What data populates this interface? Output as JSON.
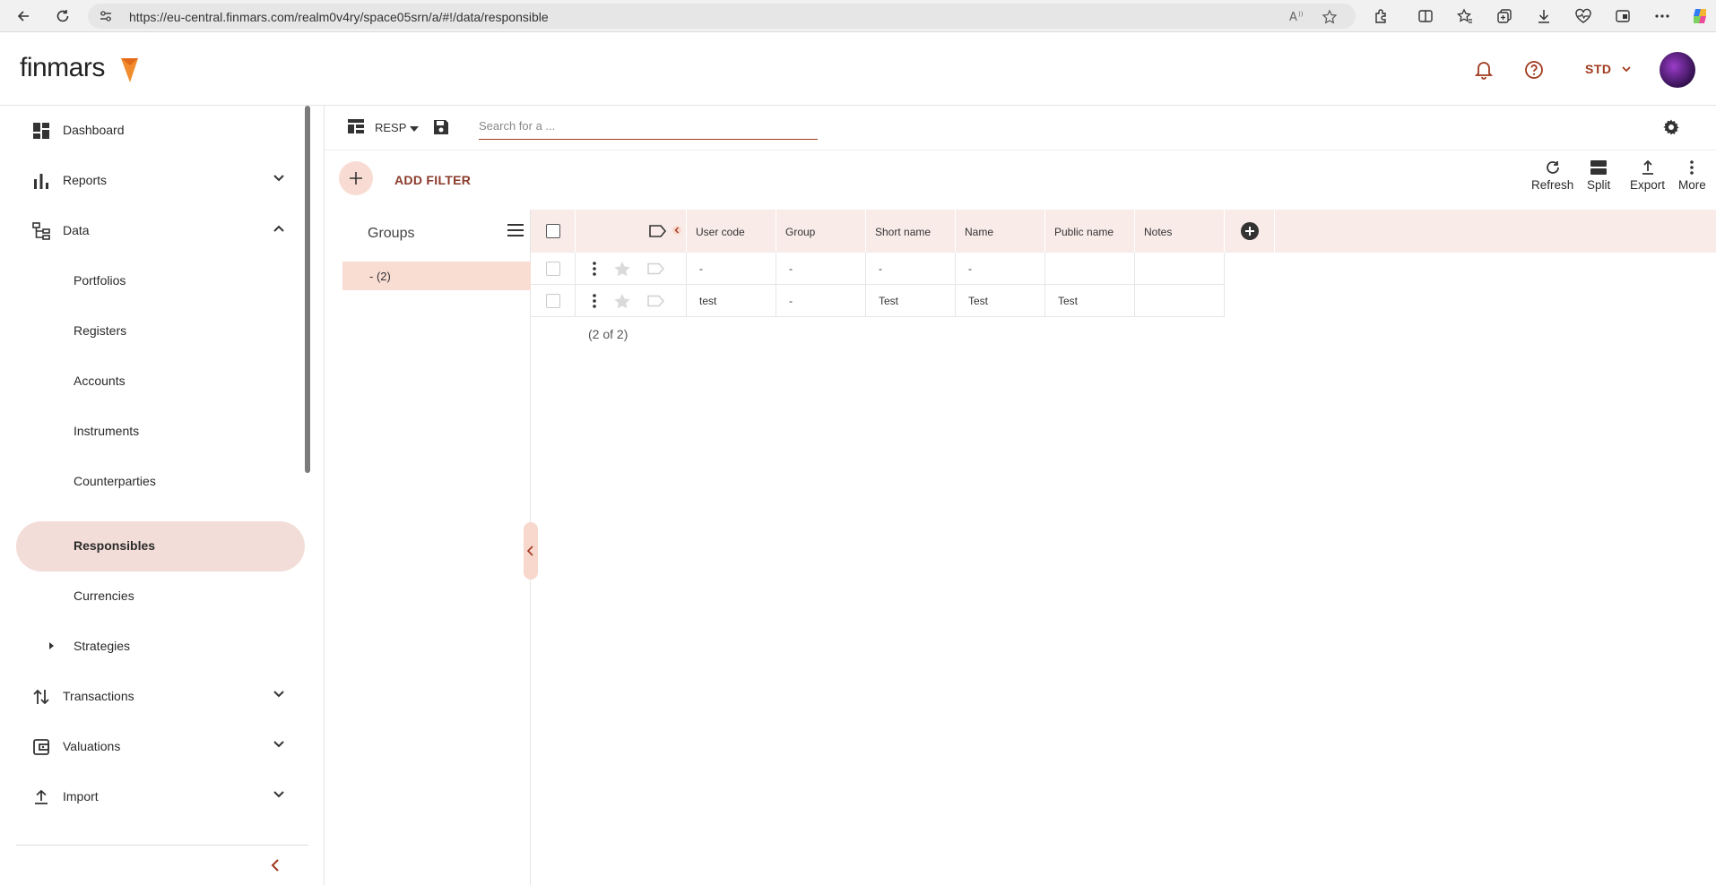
{
  "browser": {
    "url": "https://eu-central.finmars.com/realm0v4ry/space05srn/a/#!/data/responsible"
  },
  "header": {
    "logo_text": "finmars",
    "env_label": "STD",
    "accent_color": "#a0391e"
  },
  "sidebar": {
    "items": [
      {
        "label": "Dashboard",
        "icon": "dashboard-icon"
      },
      {
        "label": "Reports",
        "icon": "bar-chart-icon"
      },
      {
        "label": "Data",
        "icon": "hierarchy-icon"
      },
      {
        "label": "Portfolios"
      },
      {
        "label": "Registers"
      },
      {
        "label": "Accounts"
      },
      {
        "label": "Instruments"
      },
      {
        "label": "Counterparties"
      },
      {
        "label": "Responsibles"
      },
      {
        "label": "Currencies"
      },
      {
        "label": "Strategies"
      },
      {
        "label": "Transactions",
        "icon": "transfer-arrows-icon"
      },
      {
        "label": "Valuations",
        "icon": "wallet-icon"
      },
      {
        "label": "Import",
        "icon": "upload-icon"
      }
    ],
    "active": "Responsibles"
  },
  "toolbar": {
    "layout_name": "RESP",
    "search_placeholder": "Search for a ..."
  },
  "filter": {
    "add_label": "ADD FILTER"
  },
  "actions": {
    "refresh": "Refresh",
    "split": "Split",
    "export": "Export",
    "more": "More"
  },
  "groups": {
    "title": "Groups",
    "rows": [
      {
        "label": "- (2)"
      }
    ]
  },
  "table": {
    "columns": [
      "User code",
      "Group",
      "Short name",
      "Name",
      "Public name",
      "Notes"
    ],
    "rows": [
      {
        "user_code": "-",
        "group": "-",
        "short_name": "-",
        "name": "-",
        "public_name": "",
        "notes": ""
      },
      {
        "user_code": "test",
        "group": "-",
        "short_name": "Test",
        "name": "Test",
        "public_name": "Test",
        "notes": ""
      }
    ],
    "count_label": "(2 of 2)"
  }
}
